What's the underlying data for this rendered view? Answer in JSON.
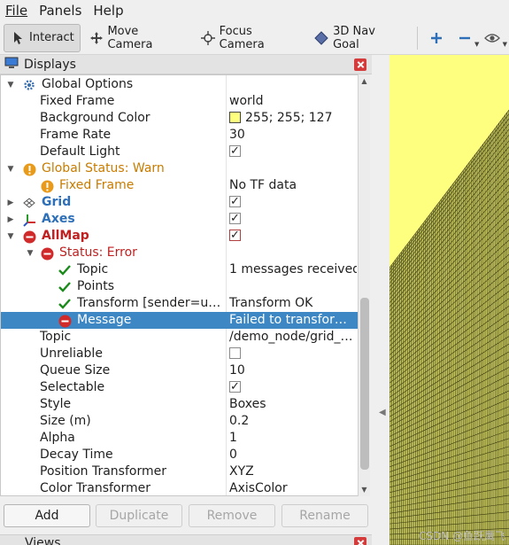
{
  "menu": [
    {
      "label": "File"
    },
    {
      "label": "Panels"
    },
    {
      "label": "Help"
    }
  ],
  "toolbar": {
    "tools": [
      {
        "label": "Interact",
        "icon": "cursor-icon",
        "active": true
      },
      {
        "label": "Move Camera",
        "icon": "move-arrows-icon",
        "active": false
      },
      {
        "label": "Focus Camera",
        "icon": "crosshair-icon",
        "active": false
      },
      {
        "label": "3D Nav Goal",
        "icon": "diamond-icon",
        "active": false
      }
    ],
    "icons": [
      "plus-icon",
      "minus-icon",
      "eye-icon"
    ]
  },
  "displays_panel": {
    "title": "Displays",
    "rows": [
      {
        "name": "Global Options",
        "value": ""
      },
      {
        "name": "Fixed Frame",
        "value": "world"
      },
      {
        "name": "Background Color",
        "value": "255; 255; 127"
      },
      {
        "name": "Frame Rate",
        "value": "30"
      },
      {
        "name": "Default Light",
        "value": ""
      },
      {
        "name": "Global Status: Warn",
        "value": ""
      },
      {
        "name": "Fixed Frame",
        "value": "No TF data"
      },
      {
        "name": "Grid",
        "value": ""
      },
      {
        "name": "Axes",
        "value": ""
      },
      {
        "name": "AllMap",
        "value": ""
      },
      {
        "name": "Status: Error",
        "value": ""
      },
      {
        "name": "Topic",
        "value": "1 messages received"
      },
      {
        "name": "Points",
        "value": ""
      },
      {
        "name": "Transform [sender=u…",
        "value": "Transform OK"
      },
      {
        "name": "Message",
        "value": "Failed to transfor…"
      },
      {
        "name": "Topic",
        "value": "/demo_node/grid_…"
      },
      {
        "name": "Unreliable",
        "value": ""
      },
      {
        "name": "Queue Size",
        "value": "10"
      },
      {
        "name": "Selectable",
        "value": ""
      },
      {
        "name": "Style",
        "value": "Boxes"
      },
      {
        "name": "Size (m)",
        "value": "0.2"
      },
      {
        "name": "Alpha",
        "value": "1"
      },
      {
        "name": "Decay Time",
        "value": "0"
      },
      {
        "name": "Position Transformer",
        "value": "XYZ"
      },
      {
        "name": "Color Transformer",
        "value": "AxisColor"
      }
    ],
    "buttons": {
      "add": "Add",
      "duplicate": "Duplicate",
      "remove": "Remove",
      "rename": "Rename"
    }
  },
  "views_panel": {
    "title": "Views"
  },
  "viewport": {
    "background_color": "#ffff7f",
    "grid_color": "#3a3a10",
    "watermark": "CSDN @鱼跃鹰飞"
  },
  "colors": {
    "warn": "#c77c00",
    "error": "#c02020",
    "ok": "#1a8a1a",
    "selection": "#3d87c4"
  }
}
